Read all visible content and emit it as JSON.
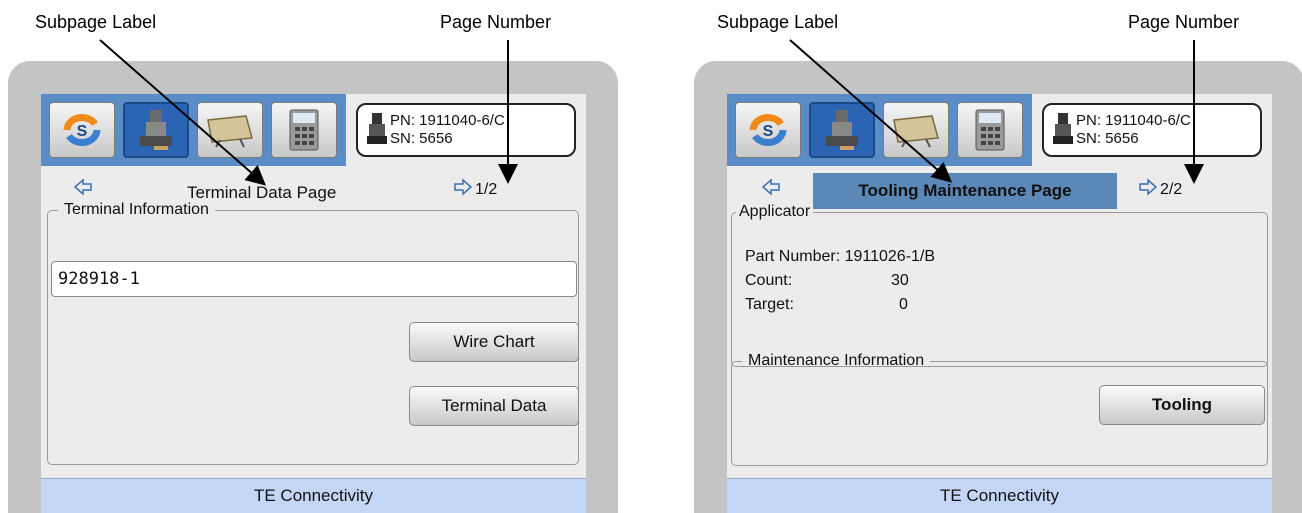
{
  "callouts": {
    "left_subpage": "Subpage Label",
    "left_page_number": "Page Number",
    "right_subpage": "Subpage Label",
    "right_page_number": "Page Number"
  },
  "colors": {
    "toolbar_bg": "#5a8cc6",
    "active_button": "#2c64b4",
    "highlight_label": "#5b88b6",
    "footer_bg": "#c4d6f5",
    "bezel": "#c4c4c4"
  },
  "toolbar_icons": [
    "sync-icon",
    "applicator-icon",
    "tooling-icon",
    "calculator-icon"
  ],
  "left_screen": {
    "pn": "PN: 1911040-6/C",
    "sn": "SN: 5656",
    "subpage_label": "Terminal Data Page",
    "page_number": "1/2",
    "group_title": "Terminal Information",
    "terminal_field_value": "928918-1",
    "wire_chart_button": "Wire Chart",
    "terminal_data_button": "Terminal Data",
    "footer": "TE Connectivity"
  },
  "right_screen": {
    "pn": "PN: 1911040-6/C",
    "sn": "SN: 5656",
    "subpage_label": "Tooling Maintenance Page",
    "page_number": "2/2",
    "applicator_group_title": "Applicator",
    "part_number": "Part Number: 1911026-1/B",
    "count_label": "Count:",
    "count_value": "30",
    "target_label": "Target:",
    "target_value": "0",
    "maintenance_group_title": "Maintenance Information",
    "tooling_button": "Tooling",
    "footer": "TE Connectivity"
  }
}
